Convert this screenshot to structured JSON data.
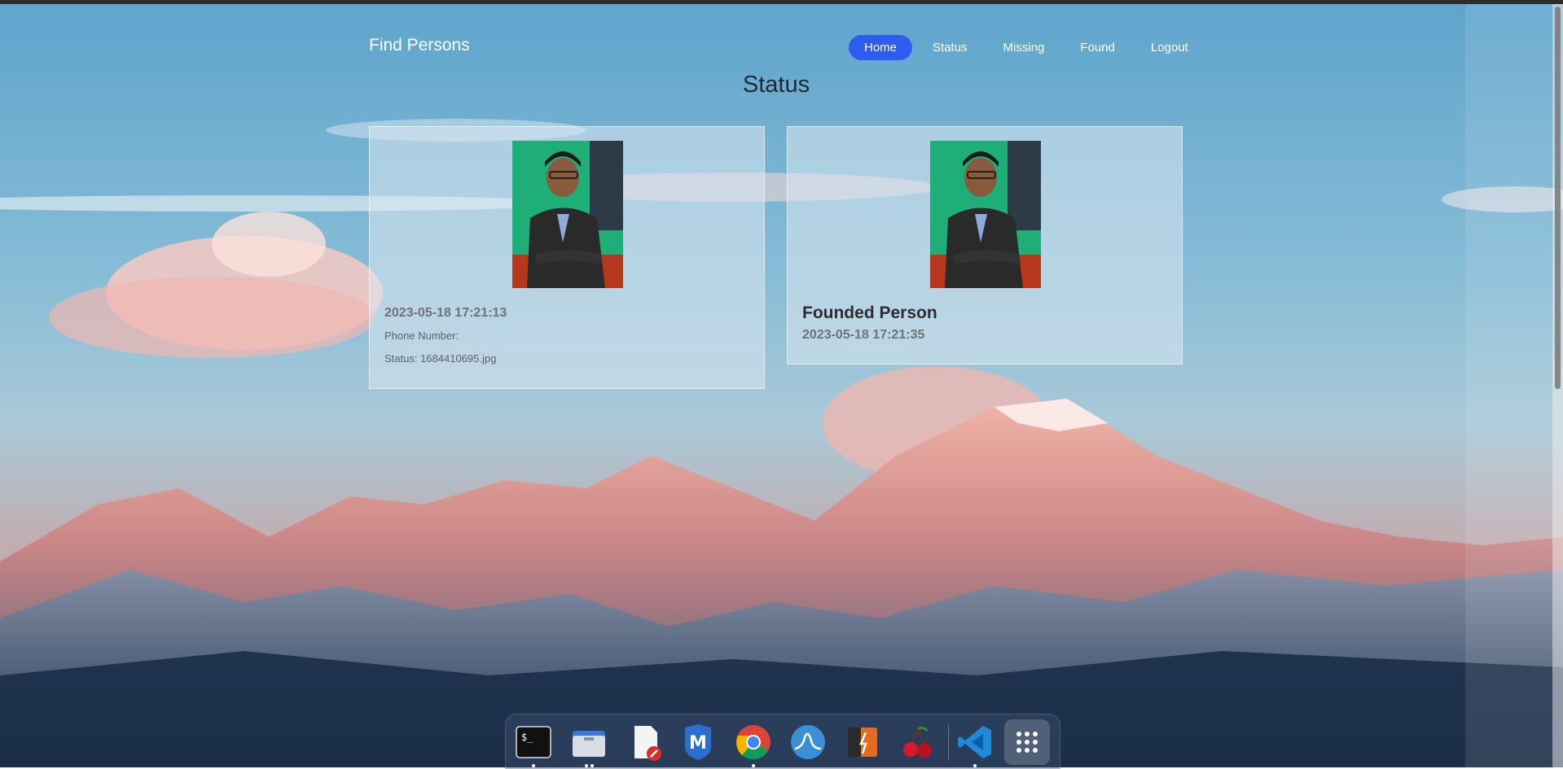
{
  "brand": "Find Persons",
  "nav": {
    "items": [
      {
        "label": "Home",
        "active": true
      },
      {
        "label": "Status",
        "active": false
      },
      {
        "label": "Missing",
        "active": false
      },
      {
        "label": "Found",
        "active": false
      },
      {
        "label": "Logout",
        "active": false
      }
    ]
  },
  "page_title": "Status",
  "missing_card": {
    "datetime": "2023-05-18 17:21:13",
    "phone_label": "Phone Number:",
    "status_text": "Status: 1684410695.jpg"
  },
  "found_card": {
    "heading": "Founded Person",
    "datetime": "2023-05-18 17:21:35"
  },
  "dock": {
    "apps": [
      "terminal-icon",
      "files-icon",
      "text-editor-icon",
      "metasploit-icon",
      "chrome-icon",
      "wireshark-icon",
      "burpsuite-icon",
      "cherrytree-icon",
      "vscode-icon",
      "app-grid-icon"
    ]
  },
  "colors": {
    "nav_active": "#2f5cf0",
    "card_bg": "rgba(220,232,240,0.55)"
  }
}
